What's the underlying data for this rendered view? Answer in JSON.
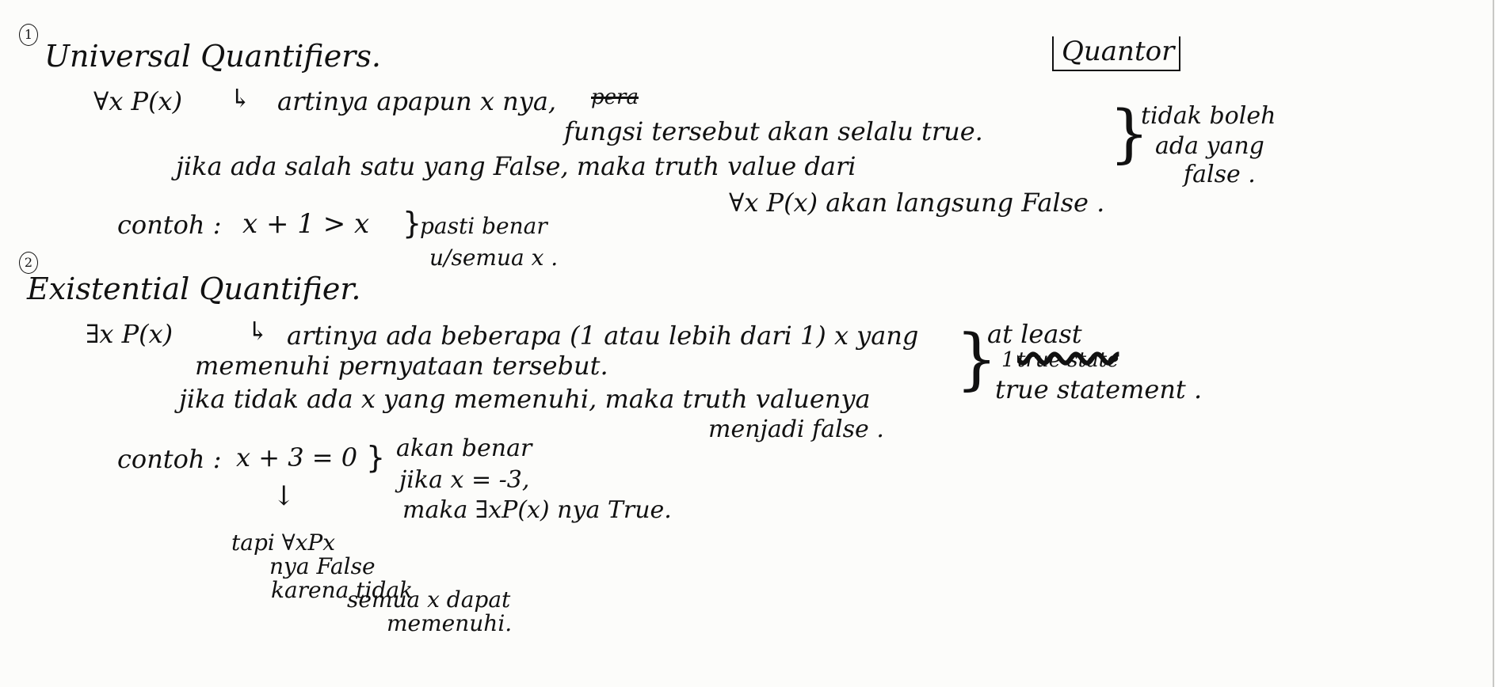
{
  "sec1": {
    "num": "1",
    "title": "Universal Quantifiers.",
    "formula": "∀x P(x)",
    "arrow": "↳",
    "line1": "artinya apapun x nya,",
    "struck": "pera",
    "line2": "fungsi tersebut akan selalu true.",
    "line3": "jika ada salah satu yang False, maka truth value dari",
    "line4": "∀x P(x) akan langsung False .",
    "example_label": "contoh :",
    "example": "x + 1 > x",
    "example_note1": "pasti benar",
    "example_note2": "u/semua x ."
  },
  "quantor": "Quantor",
  "side1": {
    "brace": "}",
    "lines": [
      "tidak boleh",
      "ada yang",
      "false ."
    ]
  },
  "sec2": {
    "num": "2",
    "title": "Existential Quantifier.",
    "formula": "∃x P(x)",
    "arrow": "↳",
    "line1": "artinya ada beberapa (1 atau lebih dari 1) x yang",
    "line2": "memenuhi pernyataan tersebut.",
    "line3": "jika tidak ada x yang memenuhi, maka truth valuenya",
    "line4": "menjadi false .",
    "example_label": "contoh :",
    "example": "x + 3 = 0",
    "example_note1": "akan benar",
    "example_note2": "jika x = -3,",
    "example_note3": "maka ∃xP(x) nya True.",
    "down_arrow": "↓",
    "note_lines": [
      "tapi ∀xPx",
      "nya False",
      "karena tidak",
      "semua x dapat",
      "memenuhi."
    ]
  },
  "side2": {
    "brace": "}",
    "line1": "at least",
    "line2_prefix": "1",
    "line2_struck": "true state",
    "line3": "true statement ."
  }
}
